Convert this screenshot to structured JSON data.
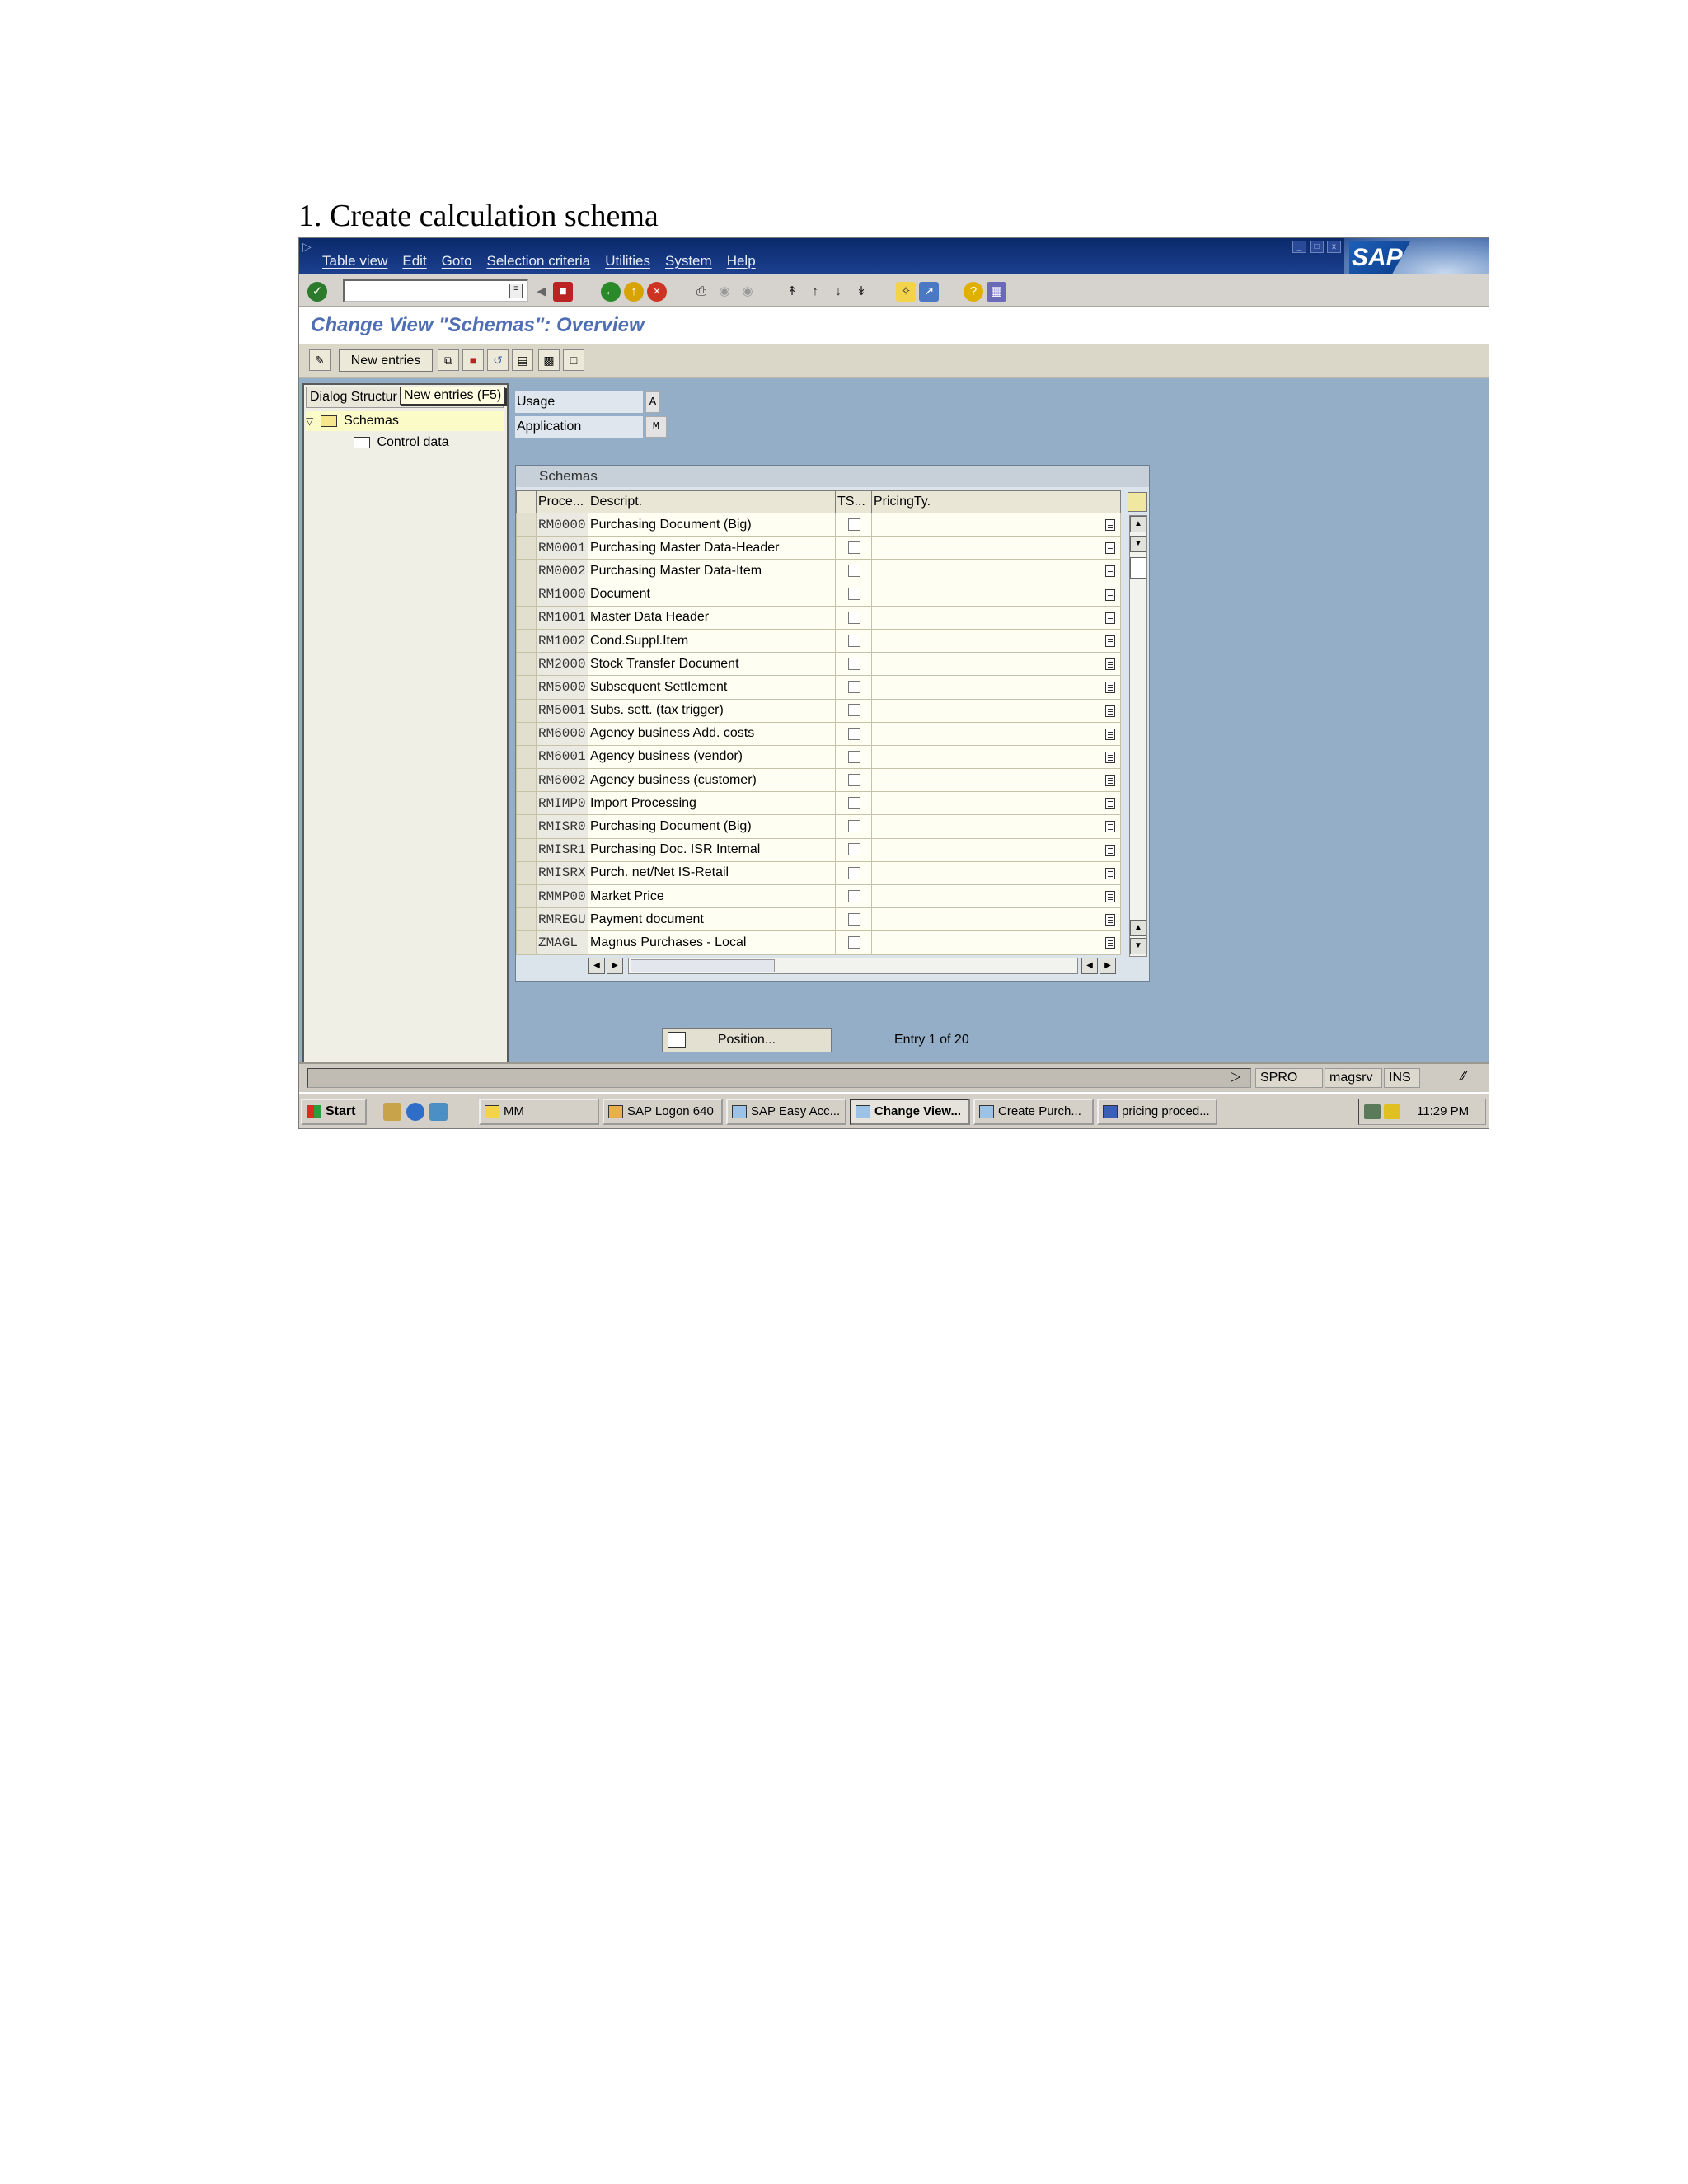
{
  "document": {
    "heading": "1.   Create calculation schema"
  },
  "menu": {
    "items": [
      "Table view",
      "Edit",
      "Goto",
      "Selection criteria",
      "Utilities",
      "System",
      "Help"
    ]
  },
  "logo_text": "SAP",
  "page_title": "Change View \"Schemas\": Overview",
  "app_toolbar": {
    "new_entries_label": "New entries",
    "tooltip": "New entries   (F5)"
  },
  "dialog_structure": {
    "header": "Dialog Structur",
    "nodes": [
      "Schemas",
      "Control data"
    ]
  },
  "fields": {
    "usage_label": "Usage",
    "usage_value": "A",
    "application_label": "Application",
    "application_value": "M"
  },
  "schemas_table": {
    "title": "Schemas",
    "columns": [
      "Proce...",
      "Descript.",
      "TS...",
      "PricingTy."
    ],
    "rows": [
      {
        "code": "RM0000",
        "description": "Purchasing Document (Big)"
      },
      {
        "code": "RM0001",
        "description": "Purchasing Master Data-Header"
      },
      {
        "code": "RM0002",
        "description": "Purchasing Master Data-Item"
      },
      {
        "code": "RM1000",
        "description": "Document"
      },
      {
        "code": "RM1001",
        "description": "Master Data Header"
      },
      {
        "code": "RM1002",
        "description": "Cond.Suppl.Item"
      },
      {
        "code": "RM2000",
        "description": "Stock Transfer Document"
      },
      {
        "code": "RM5000",
        "description": "Subsequent Settlement"
      },
      {
        "code": "RM5001",
        "description": "Subs. sett. (tax trigger)"
      },
      {
        "code": "RM6000",
        "description": "Agency business Add. costs"
      },
      {
        "code": "RM6001",
        "description": "Agency business (vendor)"
      },
      {
        "code": "RM6002",
        "description": "Agency business (customer)"
      },
      {
        "code": "RMIMP0",
        "description": "Import Processing"
      },
      {
        "code": "RMISR0",
        "description": "Purchasing Document (Big)"
      },
      {
        "code": "RMISR1",
        "description": "Purchasing Doc. ISR Internal"
      },
      {
        "code": "RMISRX",
        "description": "Purch. net/Net IS-Retail"
      },
      {
        "code": "RMMP00",
        "description": "Market Price"
      },
      {
        "code": "RMREGU",
        "description": "Payment document"
      },
      {
        "code": "ZMAGL",
        "description": "Magnus Purchases - Local"
      }
    ]
  },
  "position_button": "Position...",
  "entry_info": "Entry 1 of 20",
  "status_bar": {
    "transaction": "SPRO",
    "server": "magsrv",
    "mode": "INS"
  },
  "taskbar": {
    "start": "Start",
    "tasks": [
      "MM",
      "SAP Logon 640",
      "SAP Easy Acc...",
      "Change View...",
      "Create Purch...",
      "pricing proced..."
    ],
    "active_task": "Change View...",
    "clock": "11:29 PM"
  }
}
